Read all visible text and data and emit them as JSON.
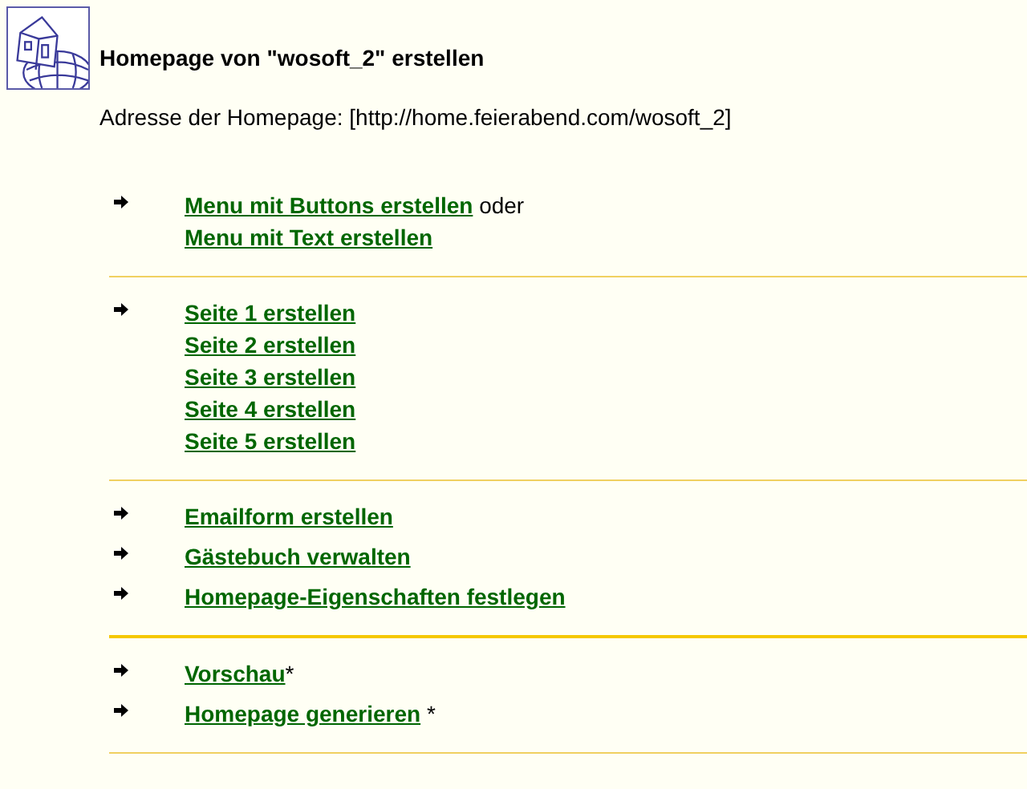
{
  "header": {
    "title": "Homepage von \"wosoft_2\" erstellen",
    "address": "Adresse der Homepage: [http://home.feierabend.com/wosoft_2]"
  },
  "sections": [
    {
      "kind": "thin",
      "rows": [
        {
          "lines": [
            {
              "link": "Menu mit Buttons erstellen",
              "suffix": " oder"
            },
            {
              "link": "Menu mit Text erstellen"
            }
          ]
        }
      ]
    },
    {
      "kind": "thin",
      "rows": [
        {
          "lines": [
            {
              "link": "Seite 1 erstellen"
            },
            {
              "link": "Seite 2 erstellen"
            },
            {
              "link": "Seite 3 erstellen"
            },
            {
              "link": "Seite 4 erstellen"
            },
            {
              "link": "Seite 5 erstellen"
            }
          ]
        }
      ]
    },
    {
      "kind": "thick",
      "rows": [
        {
          "lines": [
            {
              "link": "Emailform erstellen"
            }
          ]
        },
        {
          "lines": [
            {
              "link": "Gästebuch verwalten"
            }
          ]
        },
        {
          "lines": [
            {
              "link": "Homepage-Eigenschaften festlegen"
            }
          ]
        }
      ]
    },
    {
      "kind": "thin",
      "rows": [
        {
          "lines": [
            {
              "link": "Vorschau",
              "suffix": "*"
            }
          ]
        },
        {
          "lines": [
            {
              "link": "Homepage generieren",
              "suffix": " *"
            }
          ]
        }
      ]
    }
  ]
}
